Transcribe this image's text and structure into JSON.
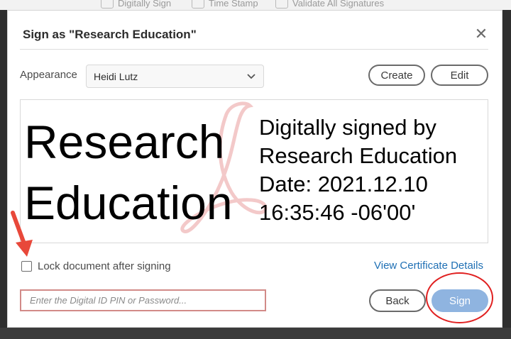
{
  "background": {
    "toolbar_items": [
      {
        "label": "Digitally Sign",
        "icon": "digital-sign-icon"
      },
      {
        "label": "Time Stamp",
        "icon": "timestamp-icon"
      },
      {
        "label": "Validate All Signatures",
        "icon": "validate-icon"
      }
    ]
  },
  "dialog": {
    "title": "Sign as \"Research Education\"",
    "close_glyph": "✕"
  },
  "appearance": {
    "label": "Appearance",
    "selected": "Heidi Lutz",
    "create_label": "Create",
    "edit_label": "Edit"
  },
  "preview": {
    "name_line1": "Research",
    "name_line2": "Education",
    "detail_line1": "Digitally signed by",
    "detail_line2": "Research Education",
    "detail_line3": "Date: 2021.12.10",
    "detail_line4": "16:35:46 -06'00'"
  },
  "options": {
    "lock_label": "Lock document after signing",
    "lock_checked": false,
    "view_certificate_label": "View Certificate Details"
  },
  "footer": {
    "pin_placeholder": "Enter the Digital ID PIN or Password...",
    "pin_value": "",
    "back_label": "Back",
    "sign_label": "Sign"
  },
  "colors": {
    "accent_link": "#1e6fb4",
    "sign_button": "#8fb4e0",
    "annotation_red": "#e02020",
    "input_error_border": "#d28a88",
    "watermark": "#f3c9c9"
  }
}
